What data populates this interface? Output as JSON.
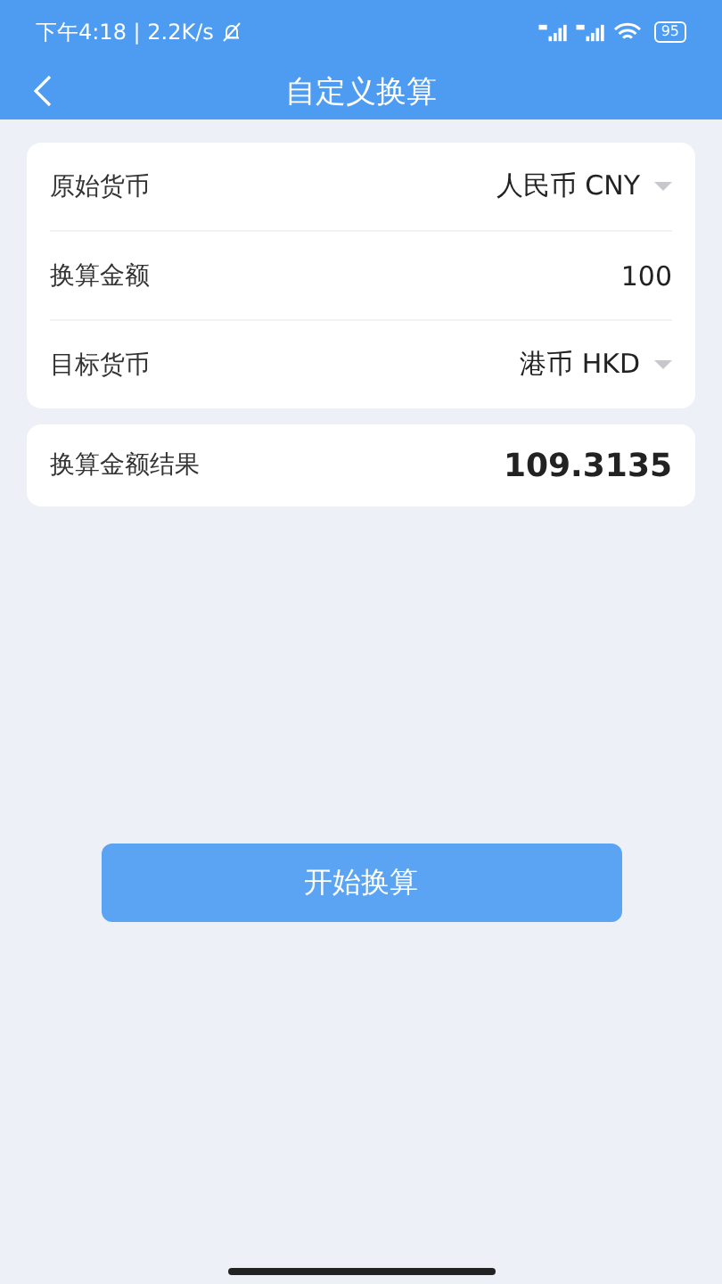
{
  "status_bar": {
    "time": "下午4:18 | 2.2K/s",
    "battery": "95"
  },
  "header": {
    "title": "自定义换算"
  },
  "form": [
    {
      "kind": "select",
      "label": "原始货币",
      "value": "人民币 CNY"
    },
    {
      "kind": "input",
      "label": "换算金额",
      "value": "100"
    },
    {
      "kind": "select",
      "label": "目标货币",
      "value": "港币 HKD"
    }
  ],
  "result": {
    "label": "换算金额结果",
    "value": "109.3135"
  },
  "button": "开始换算"
}
